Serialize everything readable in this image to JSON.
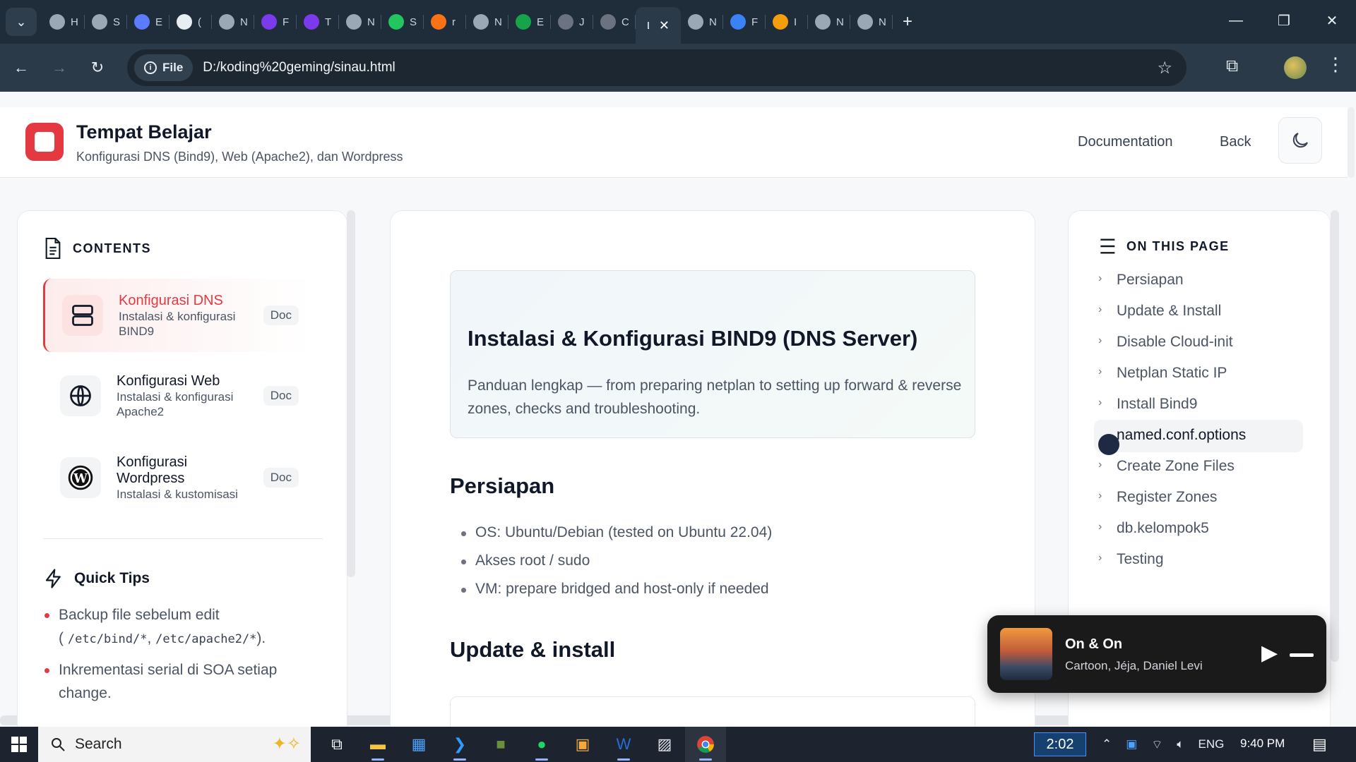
{
  "browser": {
    "tabs": [
      {
        "label": "H",
        "icon": "openai-icon",
        "color": "#9aa7b5"
      },
      {
        "label": "S",
        "icon": "play-circle-icon",
        "color": "#9aa7b5"
      },
      {
        "label": "E",
        "icon": "edge-sparkle-icon",
        "color": "#5b7cff"
      },
      {
        "label": "(",
        "icon": "z-logo-icon",
        "color": "#e6edf3"
      },
      {
        "label": "N",
        "icon": "openai-icon",
        "color": "#9aa7b5"
      },
      {
        "label": "F",
        "icon": "perplexity-d-icon",
        "color": "#7c3aed"
      },
      {
        "label": "T",
        "icon": "perplexity-d-icon",
        "color": "#7c3aed"
      },
      {
        "label": "N",
        "icon": "openai-icon",
        "color": "#9aa7b5"
      },
      {
        "label": "S",
        "icon": "vuetify-icon",
        "color": "#22c55e"
      },
      {
        "label": "r",
        "icon": "gradient-blob-icon",
        "color": "#f97316"
      },
      {
        "label": "N",
        "icon": "openai-alt-icon",
        "color": "#9aa7b5"
      },
      {
        "label": "E",
        "icon": "green-hand-icon",
        "color": "#16a34a"
      },
      {
        "label": "J",
        "icon": "globe-grey-icon",
        "color": "#6b7280"
      },
      {
        "label": "C",
        "icon": "globe-grey-icon",
        "color": "#6b7280"
      }
    ],
    "active_tab": {
      "label": "L",
      "close": "✕"
    },
    "tabs_after": [
      {
        "label": "N",
        "icon": "openai-icon",
        "color": "#9aa7b5"
      },
      {
        "label": "F",
        "icon": "plus-blue-icon",
        "color": "#3b82f6"
      },
      {
        "label": "I",
        "icon": "emoji-icon",
        "color": "#f59e0b"
      },
      {
        "label": "N",
        "icon": "openai-icon",
        "color": "#9aa7b5"
      },
      {
        "label": "N",
        "icon": "openai-icon",
        "color": "#9aa7b5"
      }
    ],
    "new_tab": "+",
    "omnibox": {
      "chip_label": "File",
      "url": "D:/koding%20geming/sinau.html"
    }
  },
  "site": {
    "title": "Tempat Belajar",
    "subtitle": "Konfigurasi DNS (Bind9), Web (Apache2), dan Wordpress",
    "nav": {
      "documentation": "Documentation",
      "back": "Back"
    },
    "accent": "#e53942"
  },
  "contents": {
    "heading": "CONTENTS",
    "items": [
      {
        "title": "Konfigurasi DNS",
        "desc": "Instalasi & konfigurasi BIND9",
        "badge": "Doc",
        "icon": "server-icon",
        "active": true
      },
      {
        "title": "Konfigurasi Web",
        "desc": "Instalasi & konfigurasi Apache2",
        "badge": "Doc",
        "icon": "globe-icon",
        "active": false
      },
      {
        "title": "Konfigurasi Wordpress",
        "desc": "Instalasi & kustomisasi",
        "badge": "Doc",
        "icon": "wordpress-icon",
        "active": false
      }
    ]
  },
  "tips": {
    "heading": "Quick Tips",
    "tip1_text": "Backup file sebelum edit",
    "tip1_open": "(",
    "tip1_code1": "/etc/bind/*",
    "tip1_sep": ",",
    "tip1_code2": "/etc/apache2/*",
    "tip1_close": ").",
    "tip2_line1": "Inkrementasi serial di SOA setiap",
    "tip2_line2": "change."
  },
  "main": {
    "hero_title": "Instalasi & Konfigurasi BIND9 (DNS Server)",
    "hero_desc": "Panduan lengkap — from preparing netplan to setting up forward & reverse zones, checks and troubleshooting.",
    "section1": "Persiapan",
    "bullets": [
      "OS: Ubuntu/Debian (tested on Ubuntu 22.04)",
      "Akses root / sudo",
      "VM: prepare bridged and host-only if needed"
    ],
    "section2": "Update & install"
  },
  "toc": {
    "heading": "ON THIS PAGE",
    "items": [
      "Persiapan",
      "Update & Install",
      "Disable Cloud-init",
      "Netplan Static IP",
      "Install Bind9",
      "named.conf.options",
      "Create Zone Files",
      "Register Zones",
      "db.kelompok5",
      "Testing"
    ],
    "active_index": 5
  },
  "media": {
    "title": "On & On",
    "artist": "Cartoon, Jéja, Daniel Levi"
  },
  "taskbar": {
    "search_label": "Search",
    "badge_time": "2:02",
    "lang": "ENG",
    "clock": "9:40 PM"
  }
}
